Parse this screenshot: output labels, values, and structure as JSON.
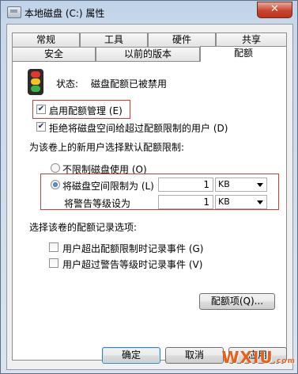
{
  "window": {
    "title": "本地磁盘 (C:) 属性",
    "close_label": "✕",
    "icon": "drive-icon"
  },
  "tabs": {
    "row1": [
      "常规",
      "工具",
      "硬件",
      "共享"
    ],
    "row2": [
      "安全",
      "以前的版本",
      "配额"
    ],
    "active": "配额"
  },
  "status": {
    "label": "状态:",
    "value": "磁盘配额已被禁用",
    "icon": "traffic-light-icon"
  },
  "options": {
    "enable_quota": {
      "label": "启用配额管理 (E)",
      "checked": true
    },
    "deny_space": {
      "label": "拒绝将磁盘空间给超过配额限制的用户 (D)",
      "checked": true
    }
  },
  "default_limit": {
    "heading": "为该卷上的新用户选择默认配额限制:",
    "no_limit": {
      "label": "不限制磁盘使用 (O)",
      "selected": false
    },
    "limit": {
      "label": "将磁盘空间限制为 (L)",
      "selected": true,
      "value": "1",
      "unit": "KB"
    },
    "warning": {
      "label": "将警告等级设为",
      "value": "1",
      "unit": "KB"
    }
  },
  "logging": {
    "heading": "选择该卷的配额记录选项:",
    "over_limit": {
      "label": "用户超出配额限制时记录事件 (G)",
      "checked": false
    },
    "over_warning": {
      "label": "用户超过警告等级时记录事件 (V)",
      "checked": false
    }
  },
  "buttons": {
    "quota_entries": "配额项(Q)...",
    "ok": "确定",
    "cancel": "取消",
    "apply": "应用"
  },
  "watermark": {
    "text": "WXIU",
    "suffix": ".com"
  },
  "colors": {
    "highlight_box": "#d53b36",
    "light_red": "#e23a2a",
    "light_yellow": "#f2c51e",
    "light_green": "#38b449"
  }
}
